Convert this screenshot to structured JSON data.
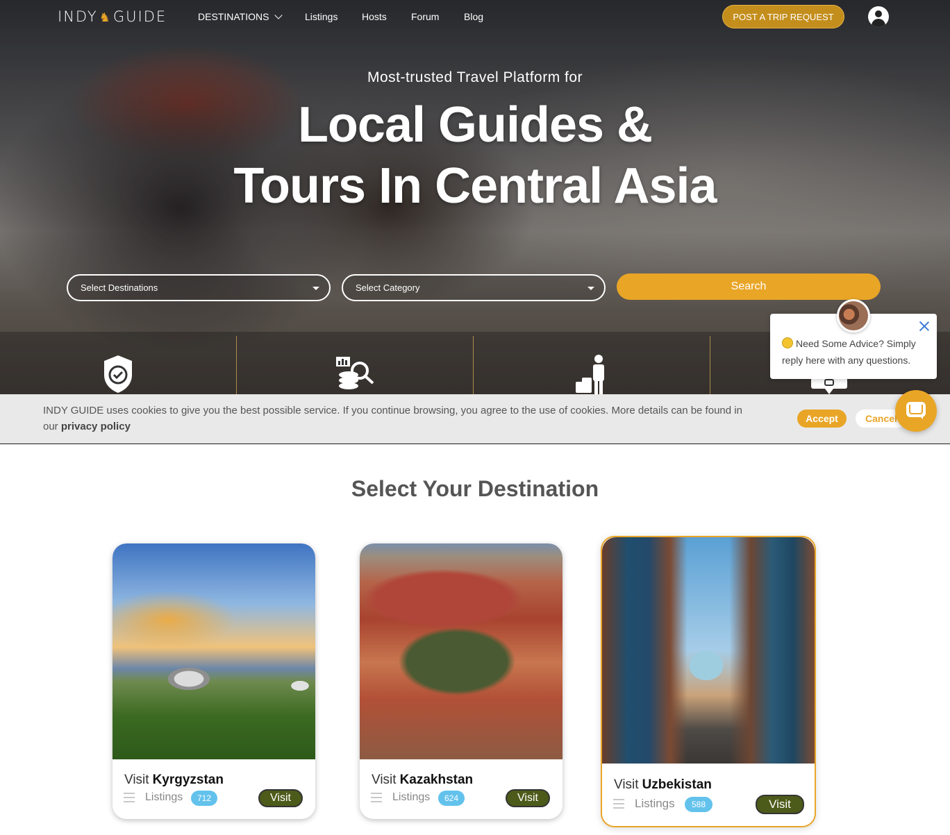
{
  "nav": {
    "logo_left": "INDY",
    "logo_right": "GUIDE",
    "destinations": "DESTINATIONS",
    "listings": "Listings",
    "hosts": "Hosts",
    "forum": "Forum",
    "blog": "Blog",
    "post_trip": "POST A TRIP REQUEST"
  },
  "hero": {
    "tagline": "Most-trusted Travel Platform for",
    "headline": "Local Guides & Tours In Central Asia"
  },
  "search": {
    "destinations_placeholder": "Select Destinations",
    "category_placeholder": "Select Category",
    "button": "Search"
  },
  "features": {
    "icons": [
      "shield-check-icon",
      "coins-search-icon",
      "traveler-luggage-icon",
      "chat-support-icon"
    ]
  },
  "cookie": {
    "text": "INDY GUIDE uses cookies to give you the best possible service. If you continue browsing, you agree to the use of cookies. More details can be found in our",
    "link": "privacy policy",
    "accept": "Accept",
    "cancel": "Cancel"
  },
  "chat": {
    "message": "Need Some Advice? Simply reply here with any questions."
  },
  "destinations": {
    "title": "Select Your Destination",
    "visit_prefix": "Visit",
    "listings_label": "Listings",
    "visit_button": "Visit",
    "cards": [
      {
        "country": "Kyrgyzstan",
        "count": "712"
      },
      {
        "country": "Kazakhstan",
        "count": "624"
      },
      {
        "country": "Uzbekistan",
        "count": "588"
      }
    ]
  },
  "colors": {
    "accent": "#e9a526",
    "badge": "#63c2ec",
    "visit_button": "#4d5b1a"
  }
}
